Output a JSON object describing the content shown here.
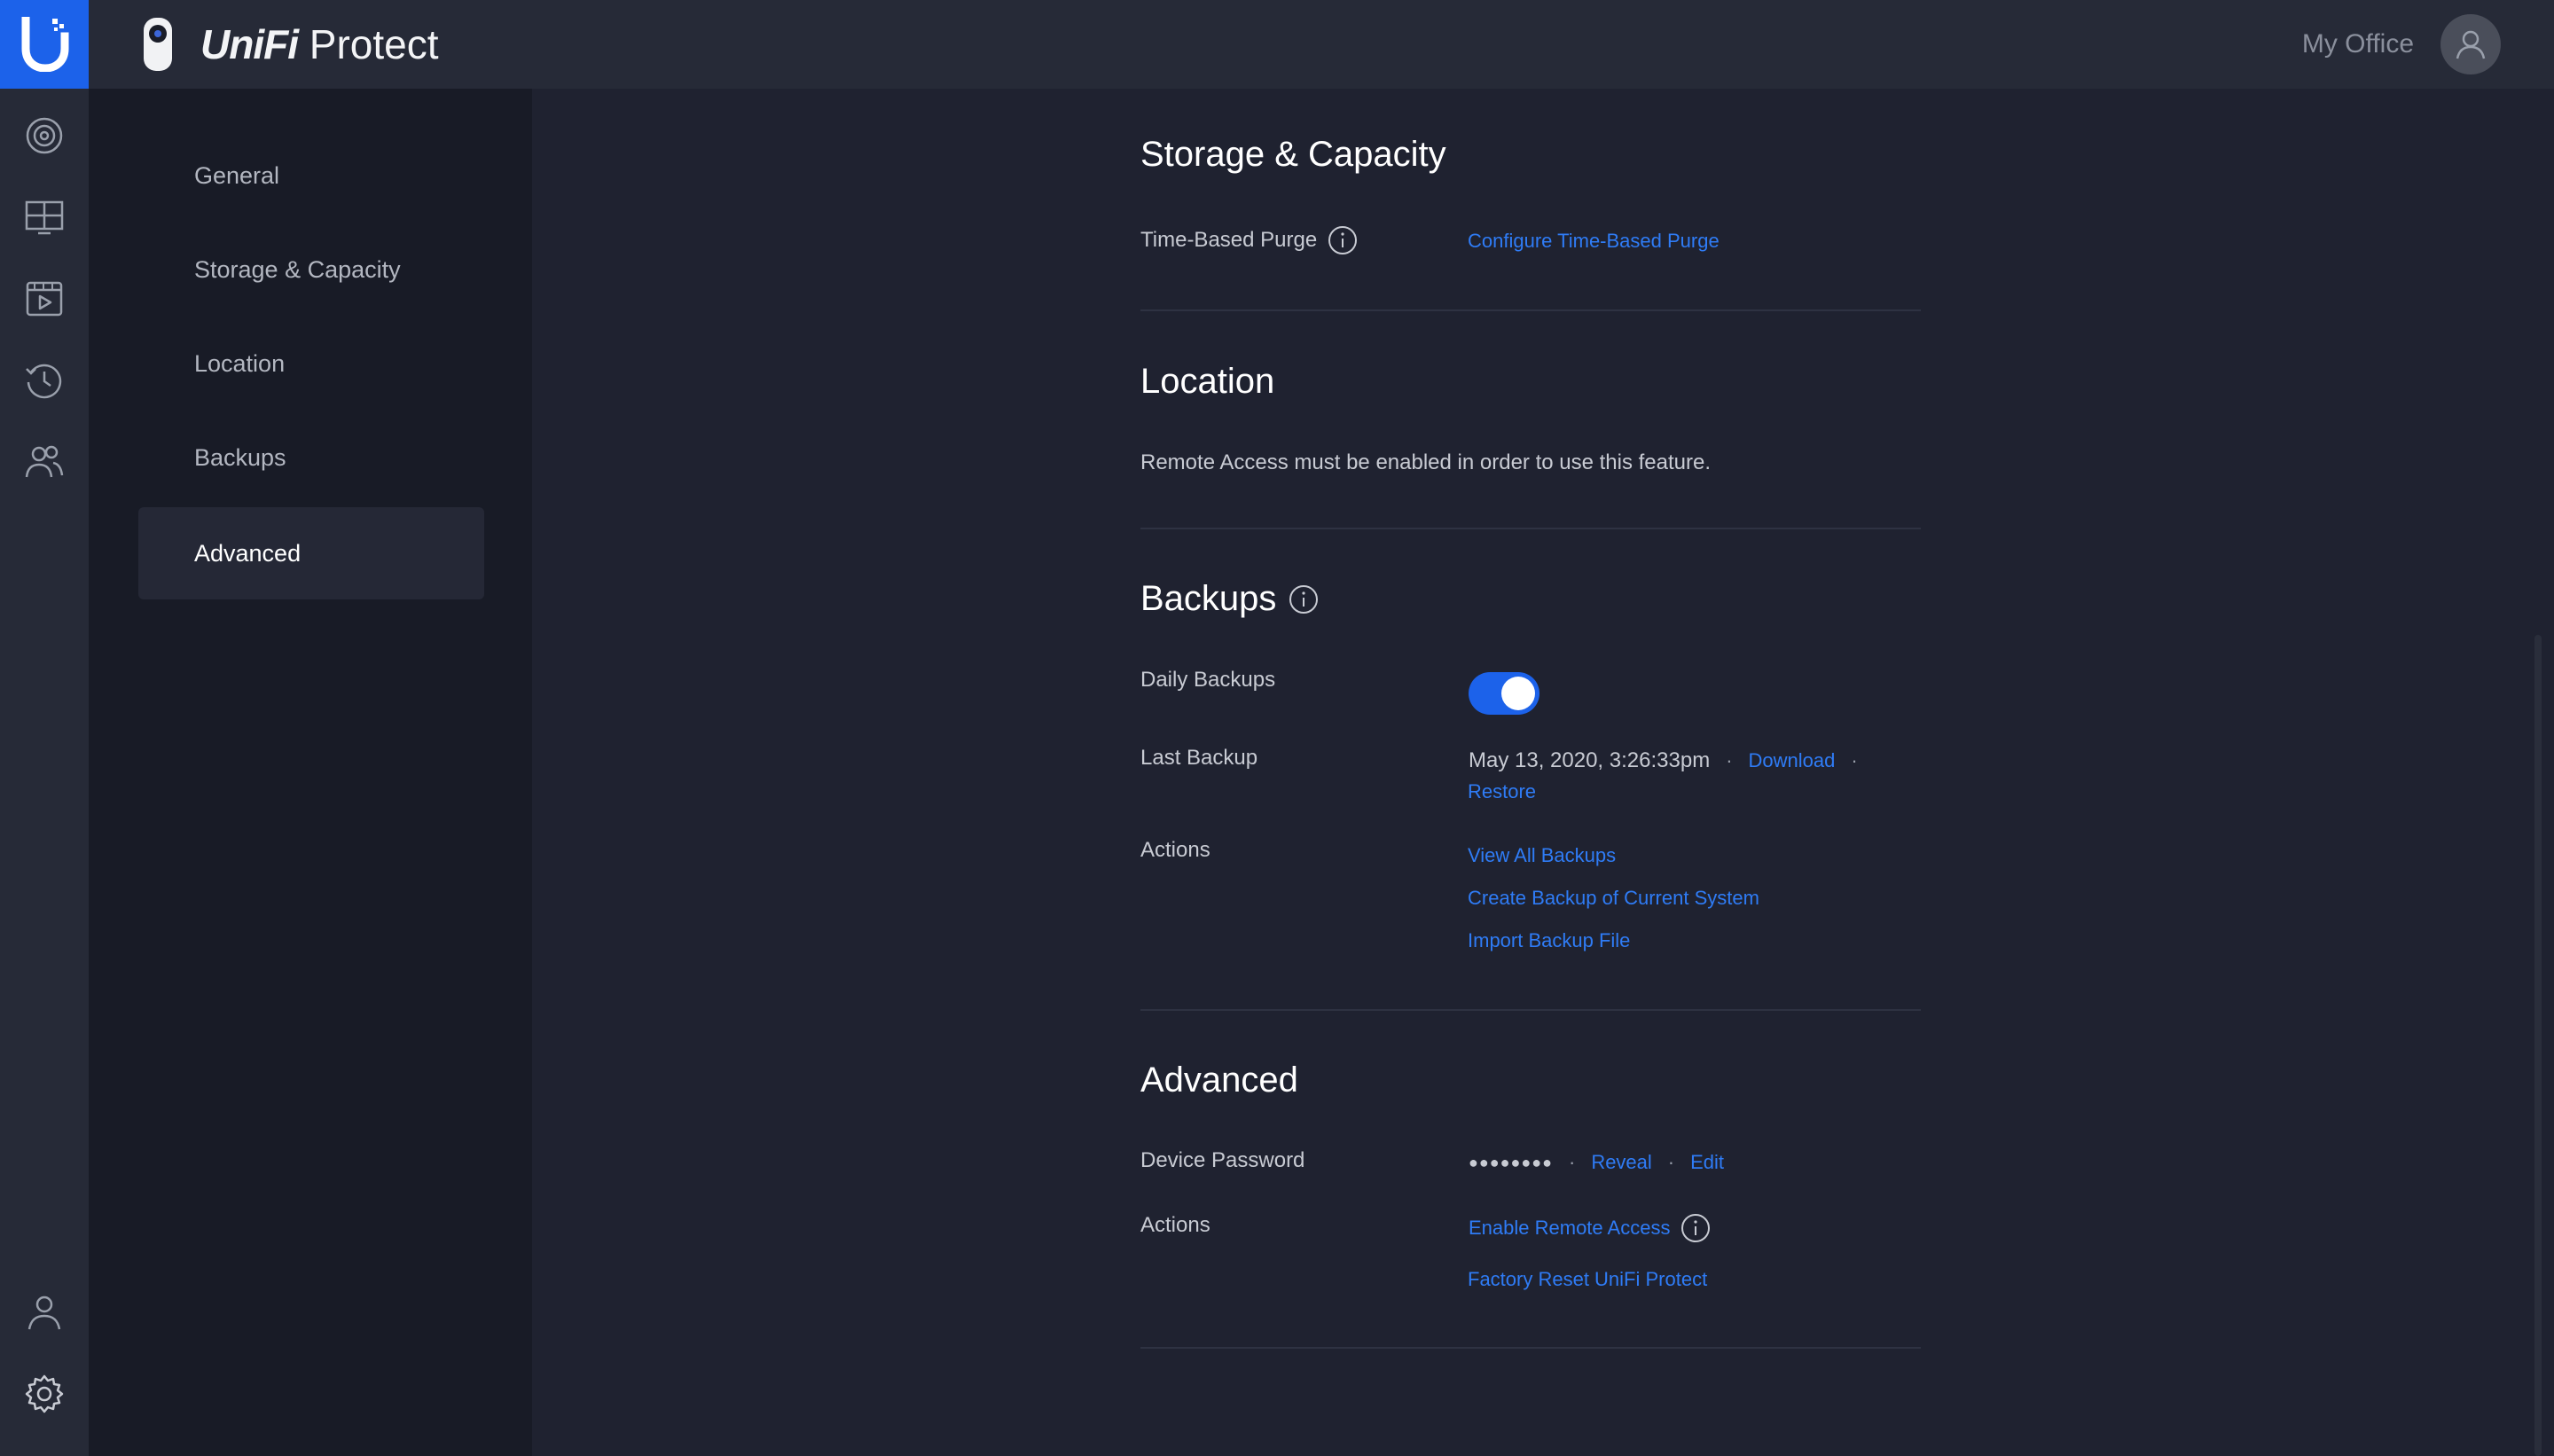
{
  "header": {
    "brand_main": "UniFi",
    "brand_sub": "Protect",
    "account_name": "My Office"
  },
  "rail": {
    "items": [
      {
        "name": "cameras-icon"
      },
      {
        "name": "liveview-icon"
      },
      {
        "name": "playback-icon"
      },
      {
        "name": "history-icon"
      },
      {
        "name": "users-icon"
      },
      {
        "name": "profile-icon"
      },
      {
        "name": "settings-icon"
      }
    ]
  },
  "nav": {
    "items": [
      {
        "label": "General"
      },
      {
        "label": "Storage & Capacity"
      },
      {
        "label": "Location"
      },
      {
        "label": "Backups"
      },
      {
        "label": "Advanced"
      }
    ],
    "active": "Advanced"
  },
  "storage": {
    "title": "Storage & Capacity",
    "purge_label": "Time-Based Purge",
    "purge_link": "Configure Time-Based Purge"
  },
  "location": {
    "title": "Location",
    "message": "Remote Access must be enabled in order to use this feature."
  },
  "backups": {
    "title": "Backups",
    "daily_label": "Daily Backups",
    "daily_enabled": true,
    "last_label": "Last Backup",
    "last_value": "May 13, 2020, 3:26:33pm",
    "download_link": "Download",
    "restore_link": "Restore",
    "actions_label": "Actions",
    "actions": [
      "View All Backups",
      "Create Backup of Current System",
      "Import Backup File"
    ]
  },
  "advanced": {
    "title": "Advanced",
    "password_label": "Device Password",
    "password_mask": "●●●●●●●●",
    "reveal_link": "Reveal",
    "edit_link": "Edit",
    "actions_label": "Actions",
    "remote_access_link": "Enable Remote Access",
    "factory_reset_link": "Factory Reset UniFi Protect"
  },
  "colors": {
    "accent": "#1c62ea",
    "link": "#2f7cf6",
    "background": "#1f2230",
    "sidebar": "#181b26"
  }
}
